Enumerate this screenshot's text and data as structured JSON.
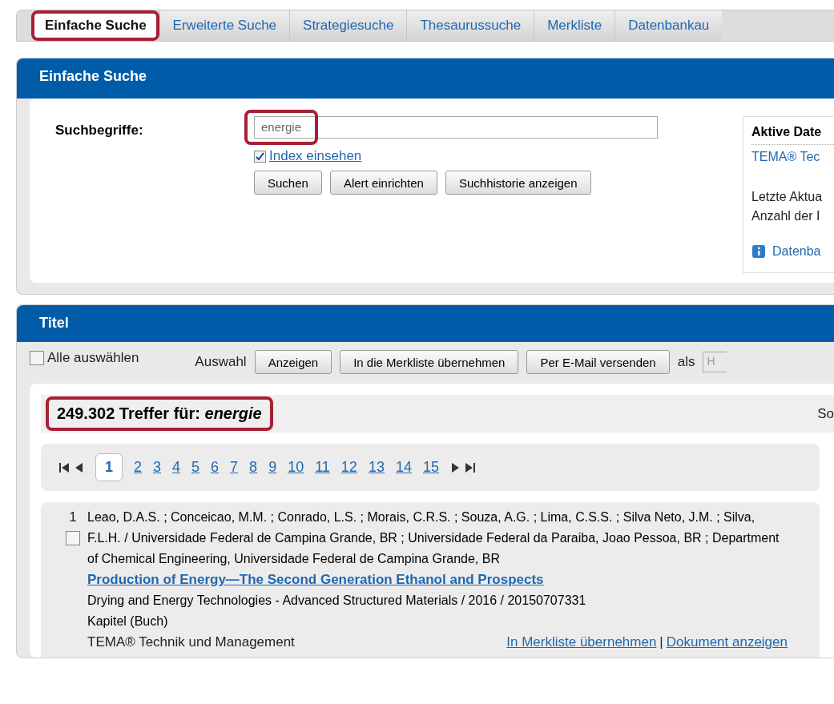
{
  "tabs": [
    {
      "label": "Einfache Suche",
      "selected": true,
      "highlighted": true
    },
    {
      "label": "Erweiterte Suche",
      "selected": false,
      "highlighted": false
    },
    {
      "label": "Strategiesuche",
      "selected": false,
      "highlighted": false
    },
    {
      "label": "Thesaurussuche",
      "selected": false,
      "highlighted": false
    },
    {
      "label": "Merkliste",
      "selected": false,
      "highlighted": false
    },
    {
      "label": "Datenbankau",
      "selected": false,
      "highlighted": false
    }
  ],
  "search_panel": {
    "title": "Einfache Suche",
    "label": "Suchbegriffe:",
    "query": {
      "value": "energie",
      "highlighted": true
    },
    "index_checkbox": {
      "label": "Index einsehen",
      "checked": true
    },
    "buttons": [
      "Suchen",
      "Alert einrichten",
      "Suchhistorie anzeigen"
    ],
    "database_box": {
      "title": "Aktive Date",
      "database_link": "TEMA® Tec",
      "lines": [
        "Letzte Aktua",
        "Anzahl der I"
      ],
      "info_link": "Datenba"
    }
  },
  "results_panel": {
    "title": "Titel",
    "select_all": {
      "label": "Alle auswählen",
      "checked": false
    },
    "selection_label": "Auswahl",
    "buttons": [
      "Anzeigen",
      "In die Merkliste übernehmen",
      "Per E-Mail versenden"
    ],
    "format_label": "als",
    "format_value": "H",
    "hit_count": {
      "text": "249.302 Treffer für: *energie*",
      "highlighted": true
    },
    "sort_label": "So",
    "pages": [
      {
        "label": "1",
        "selected": true
      },
      {
        "label": "2",
        "selected": false
      },
      {
        "label": "3",
        "selected": false
      },
      {
        "label": "4",
        "selected": false
      },
      {
        "label": "5",
        "selected": false
      },
      {
        "label": "6",
        "selected": false
      },
      {
        "label": "7",
        "selected": false
      },
      {
        "label": "8",
        "selected": false
      },
      {
        "label": "9",
        "selected": false
      },
      {
        "label": "10",
        "selected": false
      },
      {
        "label": "11",
        "selected": false
      },
      {
        "label": "12",
        "selected": false
      },
      {
        "label": "13",
        "selected": false
      },
      {
        "label": "14",
        "selected": false
      },
      {
        "label": "15",
        "selected": false
      }
    ],
    "records": [
      {
        "number": "1",
        "checked": false,
        "authors": "Leao, D.A.S. ; Conceicao, M.M. ; Conrado, L.S. ; Morais, C.R.S. ; Souza, A.G. ; Lima, C.S.S. ; Silva Neto, J.M. ; Silva, F.L.H. / Universidade Federal de Campina Grande, BR ; Universidade Federal da Paraiba, Joao Pessoa, BR ; Department of Chemical Engineering, Universidade Federal de Campina Grande, BR",
        "title": "Production of Energy—The Second Generation Ethanol and Prospects",
        "source": "Drying and Energy Technologies - Advanced Structured Materials / 2016 / 20150707331",
        "doc_type": "Kapitel (Buch)",
        "database": "TEMA® Technik und Management",
        "actions": [
          "In Merkliste übernehmen",
          "Dokument anzeigen"
        ],
        "separator": "|"
      }
    ]
  }
}
